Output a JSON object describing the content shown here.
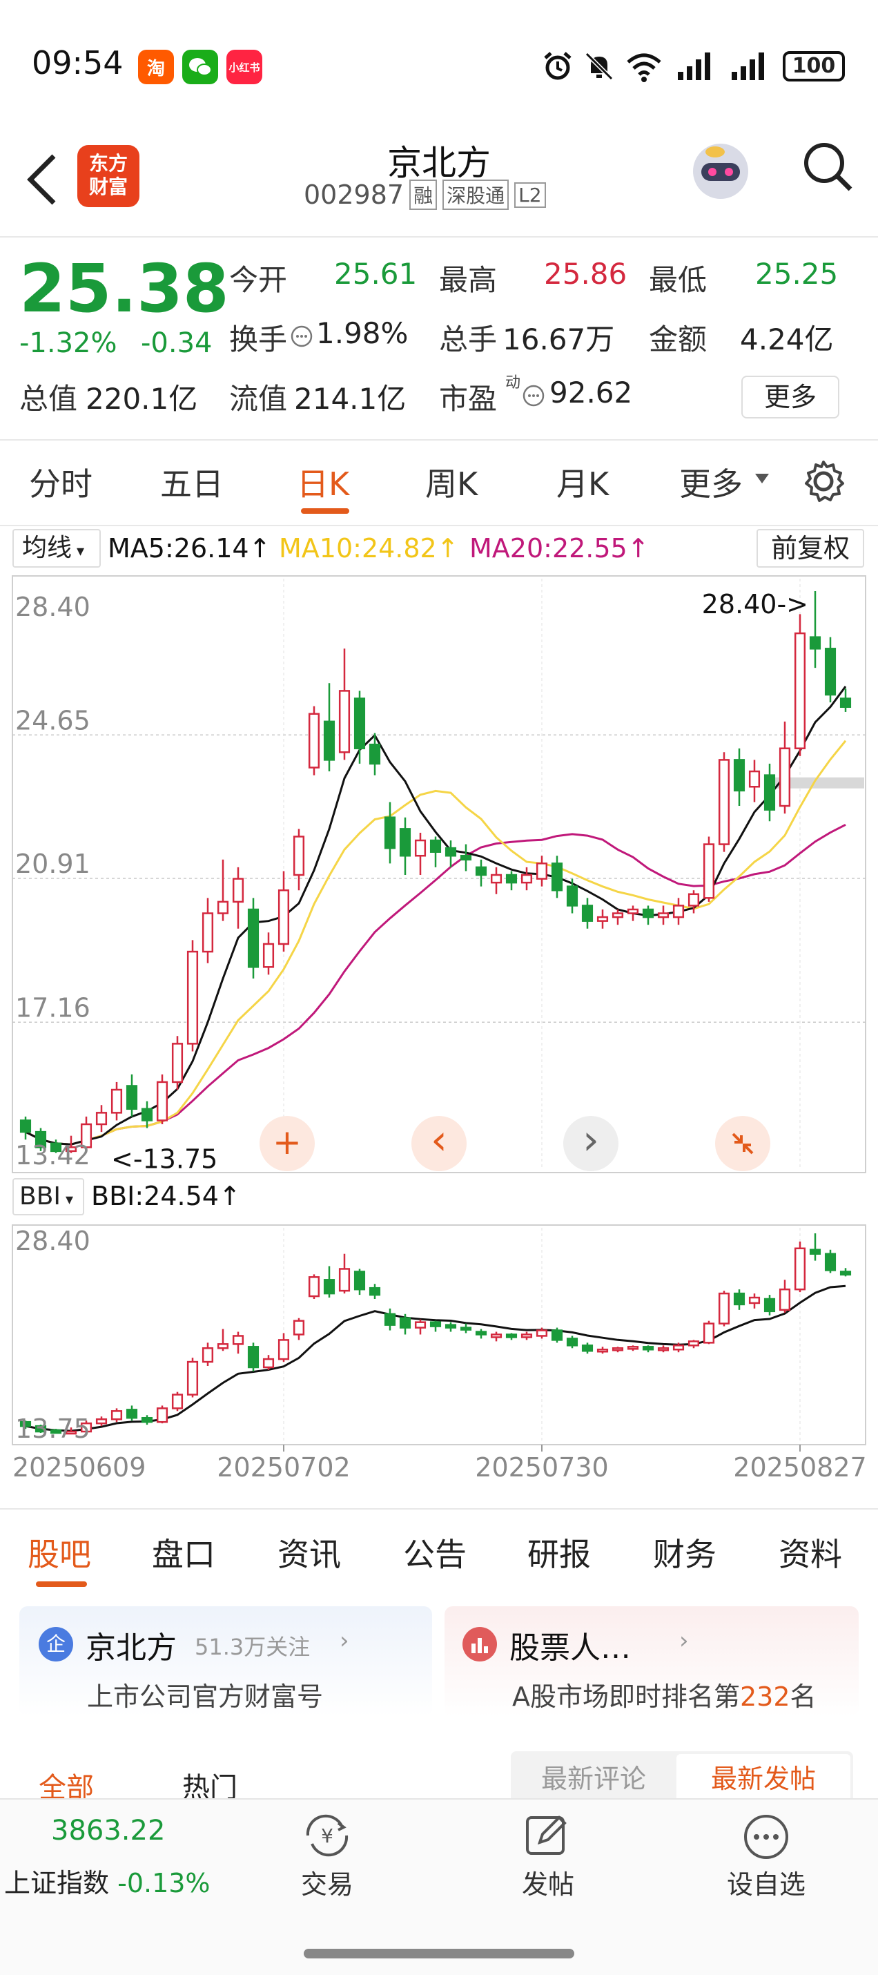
{
  "status_bar": {
    "time": "09:54",
    "apps": [
      {
        "label": "淘",
        "color": "#ff5a00"
      },
      {
        "label": "微",
        "color": "#1aad19"
      },
      {
        "label": "小红书",
        "color": "#ff2442"
      }
    ],
    "battery": "100"
  },
  "header": {
    "logo_text": "东方\n财富",
    "stock_name": "京北方",
    "stock_code": "002987",
    "tags": [
      "融",
      "深股通",
      "L2"
    ]
  },
  "quote": {
    "price": "25.38",
    "change_pct": "-1.32%",
    "change": "-0.34",
    "open_label": "今开",
    "open": "25.61",
    "high_label": "最高",
    "high": "25.86",
    "low_label": "最低",
    "low": "25.25",
    "turnover_label": "换手",
    "turnover": "1.98%",
    "volume_label": "总手",
    "volume": "16.67万",
    "amount_label": "金额",
    "amount": "4.24亿",
    "mktcap_label": "总值",
    "mktcap": "220.1亿",
    "float_label": "流值",
    "float": "214.1亿",
    "pe_label": "市盈",
    "pe_sup": "动",
    "pe": "92.62",
    "more_button": "更多"
  },
  "chart_tabs": [
    "分时",
    "五日",
    "日K",
    "周K",
    "月K",
    "更多"
  ],
  "active_chart_tab": "日K",
  "ma_bar": {
    "selector": "均线",
    "ma5": "MA5:26.14",
    "ma10": "MA10:24.82",
    "ma20": "MA20:22.55",
    "adjust": "前复权"
  },
  "bbi_bar": {
    "selector": "BBI",
    "bbi": "BBI:24.54"
  },
  "chart_data": {
    "type": "candlestick",
    "y_ticks": [
      "28.40",
      "24.65",
      "20.91",
      "17.16",
      "13.42"
    ],
    "ylim": [
      13.42,
      28.4
    ],
    "max_annotation": "28.40->",
    "min_annotation": "<-13.75",
    "bbi_y_ticks": [
      "28.40",
      "13.75"
    ],
    "x_ticks": [
      "20250609",
      "20250702",
      "20250730",
      "20250827"
    ],
    "colors": {
      "up": "#d4283e",
      "down": "#1a9a3a",
      "ma5": "#111111",
      "ma10": "#f5d547",
      "ma20": "#c0187a"
    },
    "candles": [
      {
        "o": 14.6,
        "c": 14.3,
        "h": 14.7,
        "l": 14.1
      },
      {
        "o": 14.3,
        "c": 13.9,
        "h": 14.4,
        "l": 13.8
      },
      {
        "o": 14.0,
        "c": 13.8,
        "h": 14.1,
        "l": 13.75
      },
      {
        "o": 13.8,
        "c": 13.9,
        "h": 14.2,
        "l": 13.75
      },
      {
        "o": 13.9,
        "c": 14.5,
        "h": 14.7,
        "l": 13.8
      },
      {
        "o": 14.5,
        "c": 14.8,
        "h": 15.0,
        "l": 14.3
      },
      {
        "o": 14.8,
        "c": 15.4,
        "h": 15.6,
        "l": 14.6
      },
      {
        "o": 15.5,
        "c": 14.9,
        "h": 15.8,
        "l": 14.7
      },
      {
        "o": 14.9,
        "c": 14.6,
        "h": 15.1,
        "l": 14.4
      },
      {
        "o": 14.6,
        "c": 15.6,
        "h": 15.8,
        "l": 14.5
      },
      {
        "o": 15.6,
        "c": 16.6,
        "h": 16.8,
        "l": 15.4
      },
      {
        "o": 16.6,
        "c": 19.0,
        "h": 19.3,
        "l": 16.4
      },
      {
        "o": 19.0,
        "c": 20.0,
        "h": 20.4,
        "l": 18.7
      },
      {
        "o": 20.0,
        "c": 20.3,
        "h": 21.4,
        "l": 19.8
      },
      {
        "o": 20.3,
        "c": 20.9,
        "h": 21.2,
        "l": 19.6
      },
      {
        "o": 20.1,
        "c": 18.6,
        "h": 20.4,
        "l": 18.3
      },
      {
        "o": 18.6,
        "c": 19.2,
        "h": 19.5,
        "l": 18.4
      },
      {
        "o": 19.2,
        "c": 20.6,
        "h": 21.1,
        "l": 19.0
      },
      {
        "o": 21.0,
        "c": 22.0,
        "h": 22.2,
        "l": 20.6
      },
      {
        "o": 23.8,
        "c": 25.2,
        "h": 25.4,
        "l": 23.6
      },
      {
        "o": 25.0,
        "c": 24.0,
        "h": 26.0,
        "l": 23.7
      },
      {
        "o": 24.2,
        "c": 25.8,
        "h": 26.9,
        "l": 24.0
      },
      {
        "o": 25.6,
        "c": 24.3,
        "h": 25.8,
        "l": 23.9
      },
      {
        "o": 24.4,
        "c": 23.9,
        "h": 24.7,
        "l": 23.6
      },
      {
        "o": 22.5,
        "c": 21.7,
        "h": 22.9,
        "l": 21.3
      },
      {
        "o": 22.2,
        "c": 21.5,
        "h": 22.5,
        "l": 21.0
      },
      {
        "o": 21.5,
        "c": 21.9,
        "h": 22.1,
        "l": 21.0
      },
      {
        "o": 21.9,
        "c": 21.6,
        "h": 22.0,
        "l": 21.2
      },
      {
        "o": 21.7,
        "c": 21.5,
        "h": 21.9,
        "l": 21.2
      },
      {
        "o": 21.5,
        "c": 21.4,
        "h": 21.8,
        "l": 21.1
      },
      {
        "o": 21.2,
        "c": 21.0,
        "h": 21.4,
        "l": 20.7
      },
      {
        "o": 20.8,
        "c": 21.0,
        "h": 21.2,
        "l": 20.5
      },
      {
        "o": 21.0,
        "c": 20.8,
        "h": 21.1,
        "l": 20.6
      },
      {
        "o": 20.8,
        "c": 21.0,
        "h": 21.2,
        "l": 20.6
      },
      {
        "o": 20.9,
        "c": 21.3,
        "h": 21.5,
        "l": 20.7
      },
      {
        "o": 21.3,
        "c": 20.6,
        "h": 21.5,
        "l": 20.4
      },
      {
        "o": 20.7,
        "c": 20.2,
        "h": 20.9,
        "l": 20.0
      },
      {
        "o": 20.2,
        "c": 19.8,
        "h": 20.4,
        "l": 19.6
      },
      {
        "o": 19.8,
        "c": 19.9,
        "h": 20.1,
        "l": 19.6
      },
      {
        "o": 19.9,
        "c": 20.0,
        "h": 20.1,
        "l": 19.7
      },
      {
        "o": 20.0,
        "c": 20.1,
        "h": 20.2,
        "l": 19.8
      },
      {
        "o": 20.1,
        "c": 19.9,
        "h": 20.2,
        "l": 19.7
      },
      {
        "o": 19.9,
        "c": 20.0,
        "h": 20.2,
        "l": 19.7
      },
      {
        "o": 19.9,
        "c": 20.2,
        "h": 20.4,
        "l": 19.7
      },
      {
        "o": 20.2,
        "c": 20.5,
        "h": 20.6,
        "l": 20.0
      },
      {
        "o": 20.4,
        "c": 21.8,
        "h": 22.0,
        "l": 20.3
      },
      {
        "o": 21.8,
        "c": 24.0,
        "h": 24.2,
        "l": 21.6
      },
      {
        "o": 24.0,
        "c": 23.2,
        "h": 24.3,
        "l": 22.8
      },
      {
        "o": 23.3,
        "c": 23.7,
        "h": 24.0,
        "l": 22.9
      },
      {
        "o": 23.6,
        "c": 22.7,
        "h": 23.9,
        "l": 22.4
      },
      {
        "o": 22.8,
        "c": 24.3,
        "h": 25.0,
        "l": 22.6
      },
      {
        "o": 24.3,
        "c": 27.3,
        "h": 27.8,
        "l": 24.1
      },
      {
        "o": 27.2,
        "c": 26.9,
        "h": 28.4,
        "l": 26.4
      },
      {
        "o": 26.9,
        "c": 25.7,
        "h": 27.2,
        "l": 25.5
      },
      {
        "o": 25.6,
        "c": 25.38,
        "h": 25.86,
        "l": 25.25
      }
    ]
  },
  "chart_controls": [
    {
      "icon": "plus-icon",
      "glyph": "+"
    },
    {
      "icon": "chevron-left-icon",
      "glyph": "‹"
    },
    {
      "icon": "chevron-right-icon",
      "glyph": "›"
    },
    {
      "icon": "collapse-icon",
      "glyph": "⤡"
    }
  ],
  "bottom_tabs": [
    "股吧",
    "盘口",
    "资讯",
    "公告",
    "研报",
    "财务",
    "资料"
  ],
  "active_bottom_tab": "股吧",
  "cards": [
    {
      "icon": "企",
      "title": "京北方",
      "meta": "51.3万关注",
      "sub": "上市公司官方财富号"
    },
    {
      "icon": "ill",
      "title": "股票人…",
      "sub_prefix": "A股市场即时排名第",
      "sub_rank": "232",
      "sub_suffix": "名"
    }
  ],
  "filters": {
    "left": [
      "全部",
      "热门"
    ],
    "right": [
      "最新评论",
      "最新发帖"
    ]
  },
  "bottom_nav": {
    "index_value": "3863.22",
    "index_name": "上证指数",
    "index_change": "-0.13%",
    "trade": "交易",
    "post": "发帖",
    "watch": "设自选"
  }
}
